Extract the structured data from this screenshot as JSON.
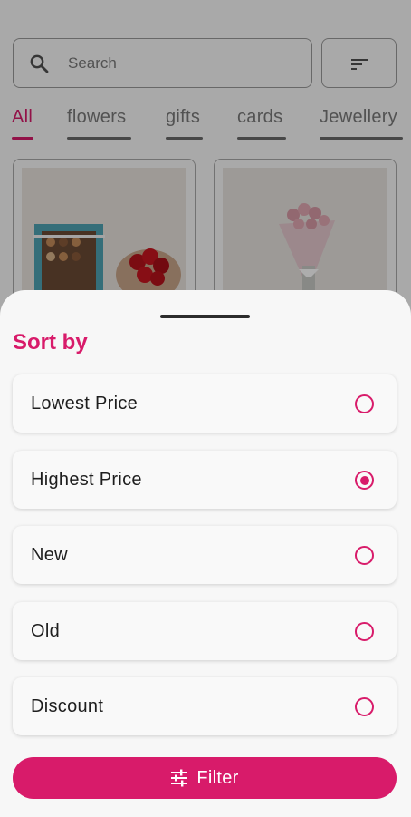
{
  "search": {
    "placeholder": "Search"
  },
  "tabs": [
    {
      "label": "All",
      "active": true
    },
    {
      "label": "flowers",
      "active": false
    },
    {
      "label": "gifts",
      "active": false
    },
    {
      "label": "cards",
      "active": false
    },
    {
      "label": "Jewellery",
      "active": false
    }
  ],
  "sort_sheet": {
    "title": "Sort by",
    "options": [
      {
        "label": "Lowest Price",
        "selected": false
      },
      {
        "label": "Highest Price",
        "selected": true
      },
      {
        "label": "New",
        "selected": false
      },
      {
        "label": "Old",
        "selected": false
      },
      {
        "label": "Discount",
        "selected": false
      }
    ],
    "filter_button_label": "Filter"
  },
  "icons": {
    "search": "search-icon",
    "sort": "sort-icon",
    "filter": "tune-icon"
  },
  "colors": {
    "accent": "#d81b6a",
    "sheet_background": "#f7f7f7"
  }
}
